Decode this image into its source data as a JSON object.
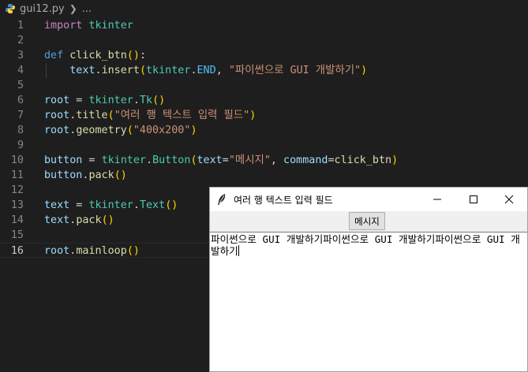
{
  "breadcrumb": {
    "file": "gui12.py",
    "trail": "..."
  },
  "editor": {
    "current_line": 16,
    "lines": [
      {
        "n": "1",
        "tokens": [
          [
            "import",
            "k-keyword"
          ],
          [
            " ",
            "k-plain"
          ],
          [
            "tkinter",
            "k-class"
          ]
        ]
      },
      {
        "n": "2",
        "tokens": []
      },
      {
        "n": "3",
        "tokens": [
          [
            "def",
            "k-def"
          ],
          [
            " ",
            "k-plain"
          ],
          [
            "click_btn",
            "k-func"
          ],
          [
            "()",
            "k-paren"
          ],
          [
            ":",
            "k-plain"
          ]
        ]
      },
      {
        "n": "4",
        "indent": true,
        "tokens": [
          [
            "    ",
            "k-plain"
          ],
          [
            "text",
            "k-var"
          ],
          [
            ".",
            "k-plain"
          ],
          [
            "insert",
            "k-func"
          ],
          [
            "(",
            "k-paren"
          ],
          [
            "tkinter",
            "k-class"
          ],
          [
            ".",
            "k-plain"
          ],
          [
            "END",
            "k-const"
          ],
          [
            ", ",
            "k-plain"
          ],
          [
            "\"파이썬으로 GUI 개발하기\"",
            "k-str"
          ],
          [
            ")",
            "k-paren"
          ]
        ]
      },
      {
        "n": "5",
        "tokens": []
      },
      {
        "n": "6",
        "tokens": [
          [
            "root",
            "k-var"
          ],
          [
            " = ",
            "k-plain"
          ],
          [
            "tkinter",
            "k-class"
          ],
          [
            ".",
            "k-plain"
          ],
          [
            "Tk",
            "k-class"
          ],
          [
            "()",
            "k-paren"
          ]
        ]
      },
      {
        "n": "7",
        "tokens": [
          [
            "root",
            "k-var"
          ],
          [
            ".",
            "k-plain"
          ],
          [
            "title",
            "k-func"
          ],
          [
            "(",
            "k-paren"
          ],
          [
            "\"여러 행 텍스트 입력 필드\"",
            "k-str"
          ],
          [
            ")",
            "k-paren"
          ]
        ]
      },
      {
        "n": "8",
        "tokens": [
          [
            "root",
            "k-var"
          ],
          [
            ".",
            "k-plain"
          ],
          [
            "geometry",
            "k-func"
          ],
          [
            "(",
            "k-paren"
          ],
          [
            "\"400x200\"",
            "k-str"
          ],
          [
            ")",
            "k-paren"
          ]
        ]
      },
      {
        "n": "9",
        "tokens": []
      },
      {
        "n": "10",
        "tokens": [
          [
            "button",
            "k-var"
          ],
          [
            " = ",
            "k-plain"
          ],
          [
            "tkinter",
            "k-class"
          ],
          [
            ".",
            "k-plain"
          ],
          [
            "Button",
            "k-class"
          ],
          [
            "(",
            "k-paren"
          ],
          [
            "text",
            "k-var"
          ],
          [
            "=",
            "k-plain"
          ],
          [
            "\"메시지\"",
            "k-str"
          ],
          [
            ", ",
            "k-plain"
          ],
          [
            "command",
            "k-var"
          ],
          [
            "=",
            "k-plain"
          ],
          [
            "click_btn",
            "k-func"
          ],
          [
            ")",
            "k-paren"
          ]
        ]
      },
      {
        "n": "11",
        "tokens": [
          [
            "button",
            "k-var"
          ],
          [
            ".",
            "k-plain"
          ],
          [
            "pack",
            "k-func"
          ],
          [
            "()",
            "k-paren"
          ]
        ]
      },
      {
        "n": "12",
        "tokens": []
      },
      {
        "n": "13",
        "tokens": [
          [
            "text",
            "k-var"
          ],
          [
            " = ",
            "k-plain"
          ],
          [
            "tkinter",
            "k-class"
          ],
          [
            ".",
            "k-plain"
          ],
          [
            "Text",
            "k-class"
          ],
          [
            "()",
            "k-paren"
          ]
        ]
      },
      {
        "n": "14",
        "tokens": [
          [
            "text",
            "k-var"
          ],
          [
            ".",
            "k-plain"
          ],
          [
            "pack",
            "k-func"
          ],
          [
            "()",
            "k-paren"
          ]
        ]
      },
      {
        "n": "15",
        "tokens": []
      },
      {
        "n": "16",
        "tokens": [
          [
            "root",
            "k-var"
          ],
          [
            ".",
            "k-plain"
          ],
          [
            "mainloop",
            "k-func"
          ],
          [
            "()",
            "k-paren"
          ]
        ]
      }
    ]
  },
  "tk_window": {
    "title": "여러 행 텍스트 입력 필드",
    "button_label": "메시지",
    "text_content": "파이썬으로 GUI 개발하기파이썬으로 GUI 개발하기파이썬으로 GUI 개발하기",
    "controls": {
      "minimize": "minimize-icon",
      "maximize": "maximize-icon",
      "close": "close-icon"
    }
  }
}
